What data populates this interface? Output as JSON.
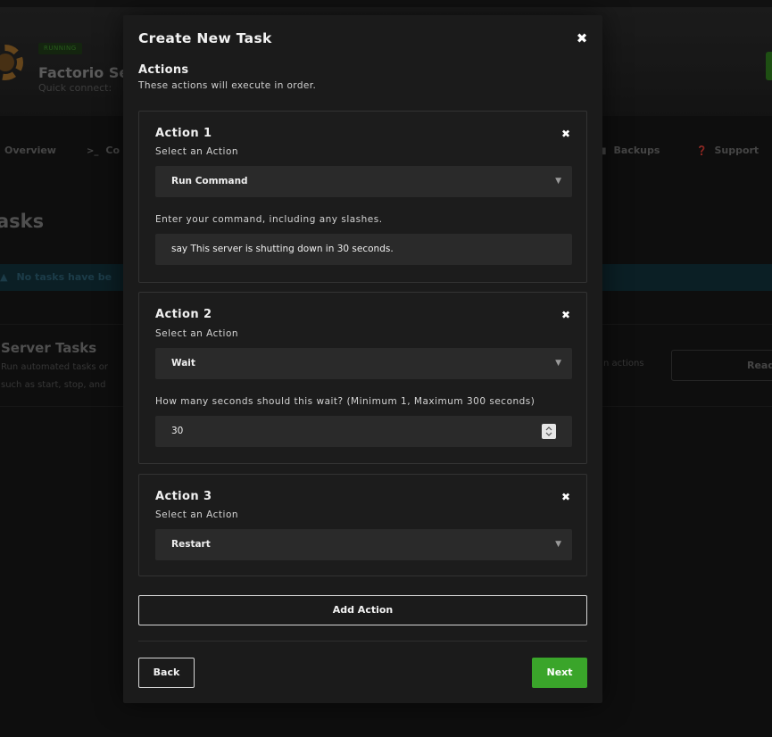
{
  "background": {
    "status_badge": "RUNNING",
    "server_name": "Factorio Se",
    "server_subtitle": "Quick connect:",
    "nav": [
      {
        "label": "Overview",
        "icon": "home-icon"
      },
      {
        "label": "Co",
        "icon": "terminal-icon"
      },
      {
        "label": "Backups",
        "icon": "lock-icon"
      },
      {
        "label": "Support",
        "icon": "help-icon"
      }
    ],
    "page_title": "asks",
    "alert_text": "No tasks have be",
    "section_title": "Server Tasks",
    "section_desc_line1": "Run automated tasks or",
    "section_desc_line2": "such as start, stop, and",
    "right_text": "n actions",
    "read_button": "Read"
  },
  "modal": {
    "title": "Create New Task",
    "section_title": "Actions",
    "section_desc": "These actions will execute in order.",
    "actions": [
      {
        "title": "Action 1",
        "select_label": "Select an Action",
        "selected": "Run Command",
        "input_label": "Enter your command, including any slashes.",
        "input_value": "say This server is shutting down in 30 seconds."
      },
      {
        "title": "Action 2",
        "select_label": "Select an Action",
        "selected": "Wait",
        "input_label": "How many seconds should this wait? (Minimum 1, Maximum 300 seconds)",
        "input_value": "30"
      },
      {
        "title": "Action 3",
        "select_label": "Select an Action",
        "selected": "Restart"
      }
    ],
    "add_action_label": "Add Action",
    "back_label": "Back",
    "next_label": "Next"
  },
  "colors": {
    "accent_green": "#3aa52a",
    "modal_bg": "#1b1b1b",
    "field_bg": "#2a2a2a"
  }
}
